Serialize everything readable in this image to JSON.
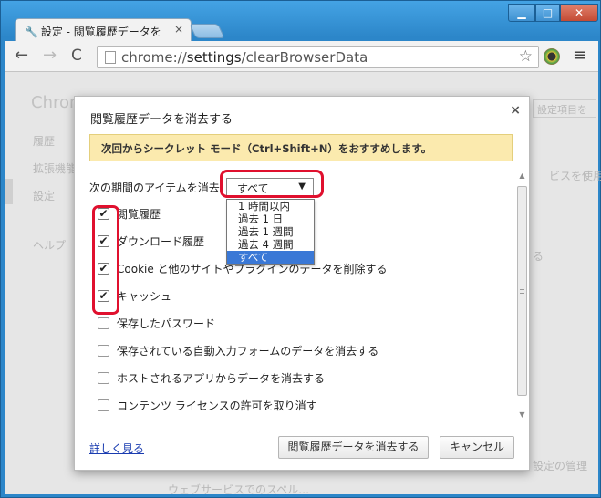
{
  "window": {
    "minimize_glyph": "▁",
    "maximize_glyph": "□",
    "close_glyph": "✕"
  },
  "tab": {
    "icon": "wrench-icon",
    "title": "設定 - 閲覧履歴データを",
    "close_glyph": "×"
  },
  "toolbar": {
    "back_glyph": "←",
    "forward_glyph": "→",
    "reload_glyph": "C",
    "url_scheme": "chrome://",
    "url_host": "settings",
    "url_path": "/clearBrowserData",
    "star_glyph": "☆",
    "menu_glyph": "≡"
  },
  "background_page": {
    "title": "Chrom",
    "nav_history": "履歴",
    "nav_extensions": "拡張機能",
    "nav_settings": "設定",
    "nav_help": "ヘルプ",
    "advanced": "設定項目を",
    "right_text1": "ビスを使用す",
    "right_text2": "る",
    "bottom_right": "設定の管理",
    "bottom_text": "ウェブサービスでのスペル…"
  },
  "dialog": {
    "title": "閲覧履歴データを消去する",
    "close_glyph": "×",
    "banner": "次回からシークレット モード（Ctrl+Shift+N）をおすすめします。",
    "period_label": "次の期間のアイテムを消去",
    "period_selected": "すべて",
    "period_arrow": "▼",
    "period_options": [
      "1 時間以内",
      "過去 1 日",
      "過去 1 週間",
      "過去 4 週間",
      "すべて"
    ],
    "items": [
      {
        "label": "閲覧履歴",
        "checked": true
      },
      {
        "label": "ダウンロード履歴",
        "checked": true
      },
      {
        "label": "Cookie と他のサイトやプラグインのデータを削除する",
        "checked": true
      },
      {
        "label": "キャッシュ",
        "checked": true
      },
      {
        "label": "保存したパスワード",
        "checked": false
      },
      {
        "label": "保存されている自動入力フォームのデータを消去する",
        "checked": false
      },
      {
        "label": "ホストされるアプリからデータを消去する",
        "checked": false
      },
      {
        "label": "コンテンツ ライセンスの許可を取り消す",
        "checked": false
      }
    ],
    "check_glyph": "✔",
    "learn_more": "詳しく見る",
    "clear_button": "閲覧履歴データを消去する",
    "cancel_button": "キャンセル",
    "scroll_up_glyph": "▲",
    "scroll_down_glyph": "▼"
  },
  "colors": {
    "highlight": "#e0102e",
    "selected_option": "#3a78d6",
    "banner_bg": "#fbeaae"
  }
}
